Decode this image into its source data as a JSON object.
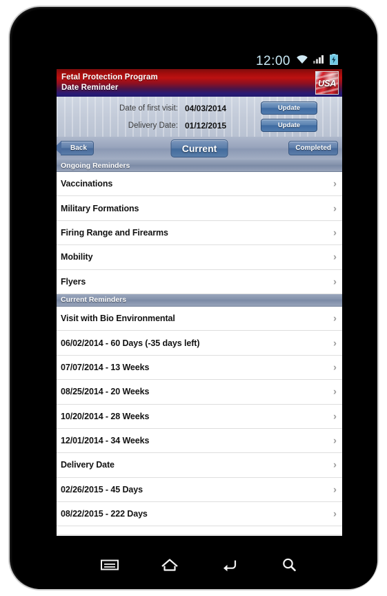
{
  "status_bar": {
    "time": "12:00",
    "icons": [
      "wifi-icon",
      "signal-icon",
      "battery-charging-icon"
    ]
  },
  "title_bar": {
    "line1": "Fetal Protection Program",
    "line2": "Date Reminder",
    "logo": "usa-flag-stamp-logo",
    "logo_text": "USA"
  },
  "dates_panel": {
    "rows": [
      {
        "label": "Date of first visit:",
        "value": "04/03/2014",
        "button": "Update"
      },
      {
        "label": "Delivery Date:",
        "value": "01/12/2015",
        "button": "Update"
      }
    ]
  },
  "tab_bar": {
    "back": "Back",
    "current": "Current",
    "completed": "Completed"
  },
  "sections": [
    {
      "header": "Ongoing Reminders",
      "rows": [
        {
          "label": "Vaccinations"
        },
        {
          "label": "Military Formations"
        },
        {
          "label": "Firing Range and Firearms"
        },
        {
          "label": "Mobility"
        },
        {
          "label": "Flyers"
        }
      ]
    },
    {
      "header": "Current Reminders",
      "rows": [
        {
          "label": "Visit with Bio Environmental"
        },
        {
          "label": "06/02/2014 - 60 Days (-35 days left)"
        },
        {
          "label": "07/07/2014 - 13 Weeks"
        },
        {
          "label": "08/25/2014 - 20 Weeks"
        },
        {
          "label": "10/20/2014 - 28 Weeks"
        },
        {
          "label": "12/01/2014 - 34 Weeks"
        },
        {
          "label": "Delivery Date"
        },
        {
          "label": "02/26/2015 - 45 Days"
        },
        {
          "label": "08/22/2015 - 222 Days"
        }
      ]
    }
  ],
  "nav_bar": {
    "buttons": [
      "menu-icon",
      "home-icon",
      "back-arrow-icon",
      "search-icon"
    ]
  },
  "colors": {
    "title_red": "#bc1111",
    "title_blue": "#201a6e",
    "accent_blue": "#47699a",
    "section_header": "#8593ac",
    "chevron_gray": "#9a9a9a"
  }
}
